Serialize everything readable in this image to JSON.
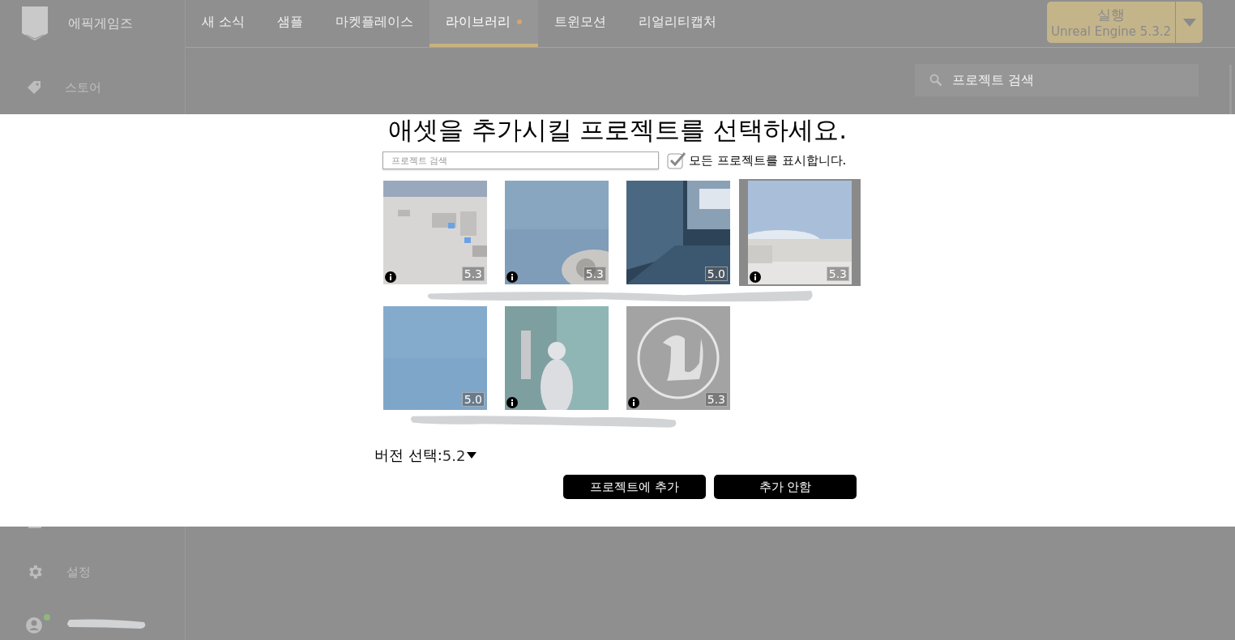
{
  "app": {
    "brand": "에픽게임즈",
    "sidebar_top": [
      {
        "label": "스토어"
      }
    ],
    "sidebar_bottom": [
      {
        "label": "설정"
      }
    ],
    "user": {
      "online": true
    },
    "tabs": [
      {
        "label": "새 소식",
        "selected": false,
        "badge": false
      },
      {
        "label": "샘플",
        "selected": false,
        "badge": false
      },
      {
        "label": "마켓플레이스",
        "selected": false,
        "badge": false
      },
      {
        "label": "라이브러리",
        "selected": true,
        "badge": true
      },
      {
        "label": "트윈모션",
        "selected": false,
        "badge": false
      },
      {
        "label": "리얼리티캡처",
        "selected": false,
        "badge": false
      }
    ],
    "launch": {
      "label": "실행",
      "version": "Unreal Engine 5.3.2"
    },
    "search": {
      "placeholder": "프로젝트 검색"
    }
  },
  "dialog": {
    "title": "애셋을 추가시킬 프로젝트를 선택하세요.",
    "search": {
      "placeholder": "프로젝트 검색"
    },
    "show_all": {
      "label": "모든 프로젝트를 표시합니다.",
      "checked": true
    },
    "projects": [
      {
        "kind": "picture",
        "version": "5.3",
        "info": true,
        "selected": false
      },
      {
        "kind": "picture",
        "version": "5.3",
        "info": true,
        "selected": false
      },
      {
        "kind": "picture",
        "version": "5.0",
        "info": false,
        "selected": false
      },
      {
        "kind": "picture",
        "version": "5.3",
        "info": true,
        "selected": true
      },
      {
        "kind": "picture",
        "version": "5.0",
        "info": false,
        "selected": false
      },
      {
        "kind": "picture",
        "info": true,
        "selected": false
      },
      {
        "kind": "picture",
        "version": "5.3",
        "info": true,
        "selected": false
      }
    ],
    "version_select": {
      "label": "버전 선택:",
      "value": "5.2"
    },
    "buttons": [
      {
        "label": "프로젝트에 추가"
      },
      {
        "label": "추가 안함"
      }
    ]
  }
}
